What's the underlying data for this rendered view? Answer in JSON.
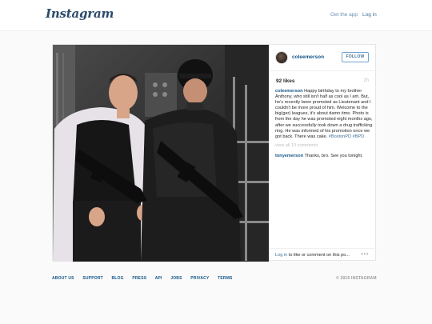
{
  "header": {
    "logo_text": "Instagram",
    "get_app_label": "Get the app",
    "login_label": "Log in"
  },
  "post": {
    "author": "coleemerson",
    "follow_label": "FOLLOW",
    "likes": "92 likes",
    "time_ago": "2h",
    "caption": {
      "username": "coleemerson",
      "text": "Happy birthday to my brother Anthony, who still isn't half as cool as I am. But, he's recently been promoted as Lieutenant and I couldn't be more proud of him. Welcome to the big(ger) leagues, it's about damn time. Photo is from the day he was promoted eight months ago, after we successfully took down a drug trafficking ring. He was informed of his promotion once we got back. There was cake.",
      "tags": "#BostonPD #BPD"
    },
    "view_all_comments": "view all 13 comments",
    "comments": [
      {
        "username": "tonyemerson",
        "text": "Thanks, bro. See you tonight."
      }
    ],
    "login_prompt_link": "Log in",
    "login_prompt_text": " to like or comment on this po...",
    "more_options_icon": "ellipsis-icon"
  },
  "footer": {
    "links": [
      "ABOUT US",
      "SUPPORT",
      "BLOG",
      "PRESS",
      "API",
      "JOBS",
      "PRIVACY",
      "TERMS"
    ],
    "copyright": "© 2015 INSTAGRAM"
  },
  "colors": {
    "link_blue": "#125688",
    "follow_border": "#6fa3d2",
    "page_bg": "#fafafa"
  }
}
